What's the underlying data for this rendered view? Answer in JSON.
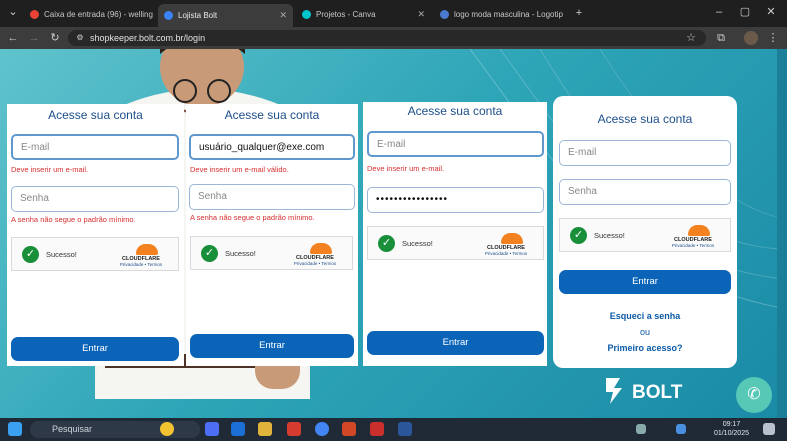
{
  "browser": {
    "tabs": [
      {
        "title": "Caixa de entrada (96) - welling",
        "color": "#ea4335"
      },
      {
        "title": "Lojista Bolt",
        "color": "#3b82f6"
      },
      {
        "title": "Projetos - Canva",
        "color": "#00c4cc"
      },
      {
        "title": "logo moda masculina - Logotip",
        "color": "#4a7bd0"
      }
    ],
    "url": "shopkeeper.bolt.com.br/login"
  },
  "cards": [
    {
      "title": "Acesse sua conta",
      "email_placeholder": "E-mail",
      "email_value": "",
      "email_error": "Deve inserir um e-mail.",
      "password_placeholder": "Senha",
      "password_value": "",
      "password_error": "A senha não segue o padrão mínimo.",
      "captcha_text": "Sucesso!",
      "button": "Entrar"
    },
    {
      "title": "Acesse sua conta",
      "email_placeholder": "E-mail",
      "email_value": "usuário_qualquer@exe.com",
      "email_error": "Deve inserir um e-mail válido.",
      "password_placeholder": "Senha",
      "password_value": "",
      "password_error": "A senha não segue o padrão mínimo.",
      "captcha_text": "Sucesso!",
      "button": "Entrar"
    },
    {
      "title": "Acesse sua conta",
      "email_placeholder": "E-mail",
      "email_value": "",
      "email_error": "Deve inserir um e-mail.",
      "password_placeholder": "Senha",
      "password_value": "••••••••••••••••",
      "password_error": "",
      "captcha_text": "Sucesso!",
      "button": "Entrar"
    },
    {
      "title": "Acesse sua conta",
      "email_placeholder": "E-mail",
      "email_value": "",
      "email_error": "",
      "password_placeholder": "Senha",
      "password_value": "",
      "password_error": "",
      "captcha_text": "Sucesso!",
      "button": "Entrar",
      "forgot": "Esqueci a senha",
      "or": "ou",
      "first_access": "Primeiro acesso?"
    }
  ],
  "cloudflare": {
    "brand": "CLOUDFLARE",
    "links": "Privacidade • Termos"
  },
  "brand_logo": "BOLT",
  "taskbar": {
    "search": "Pesquisar",
    "time": "09:17",
    "date": "01/10/2025"
  }
}
